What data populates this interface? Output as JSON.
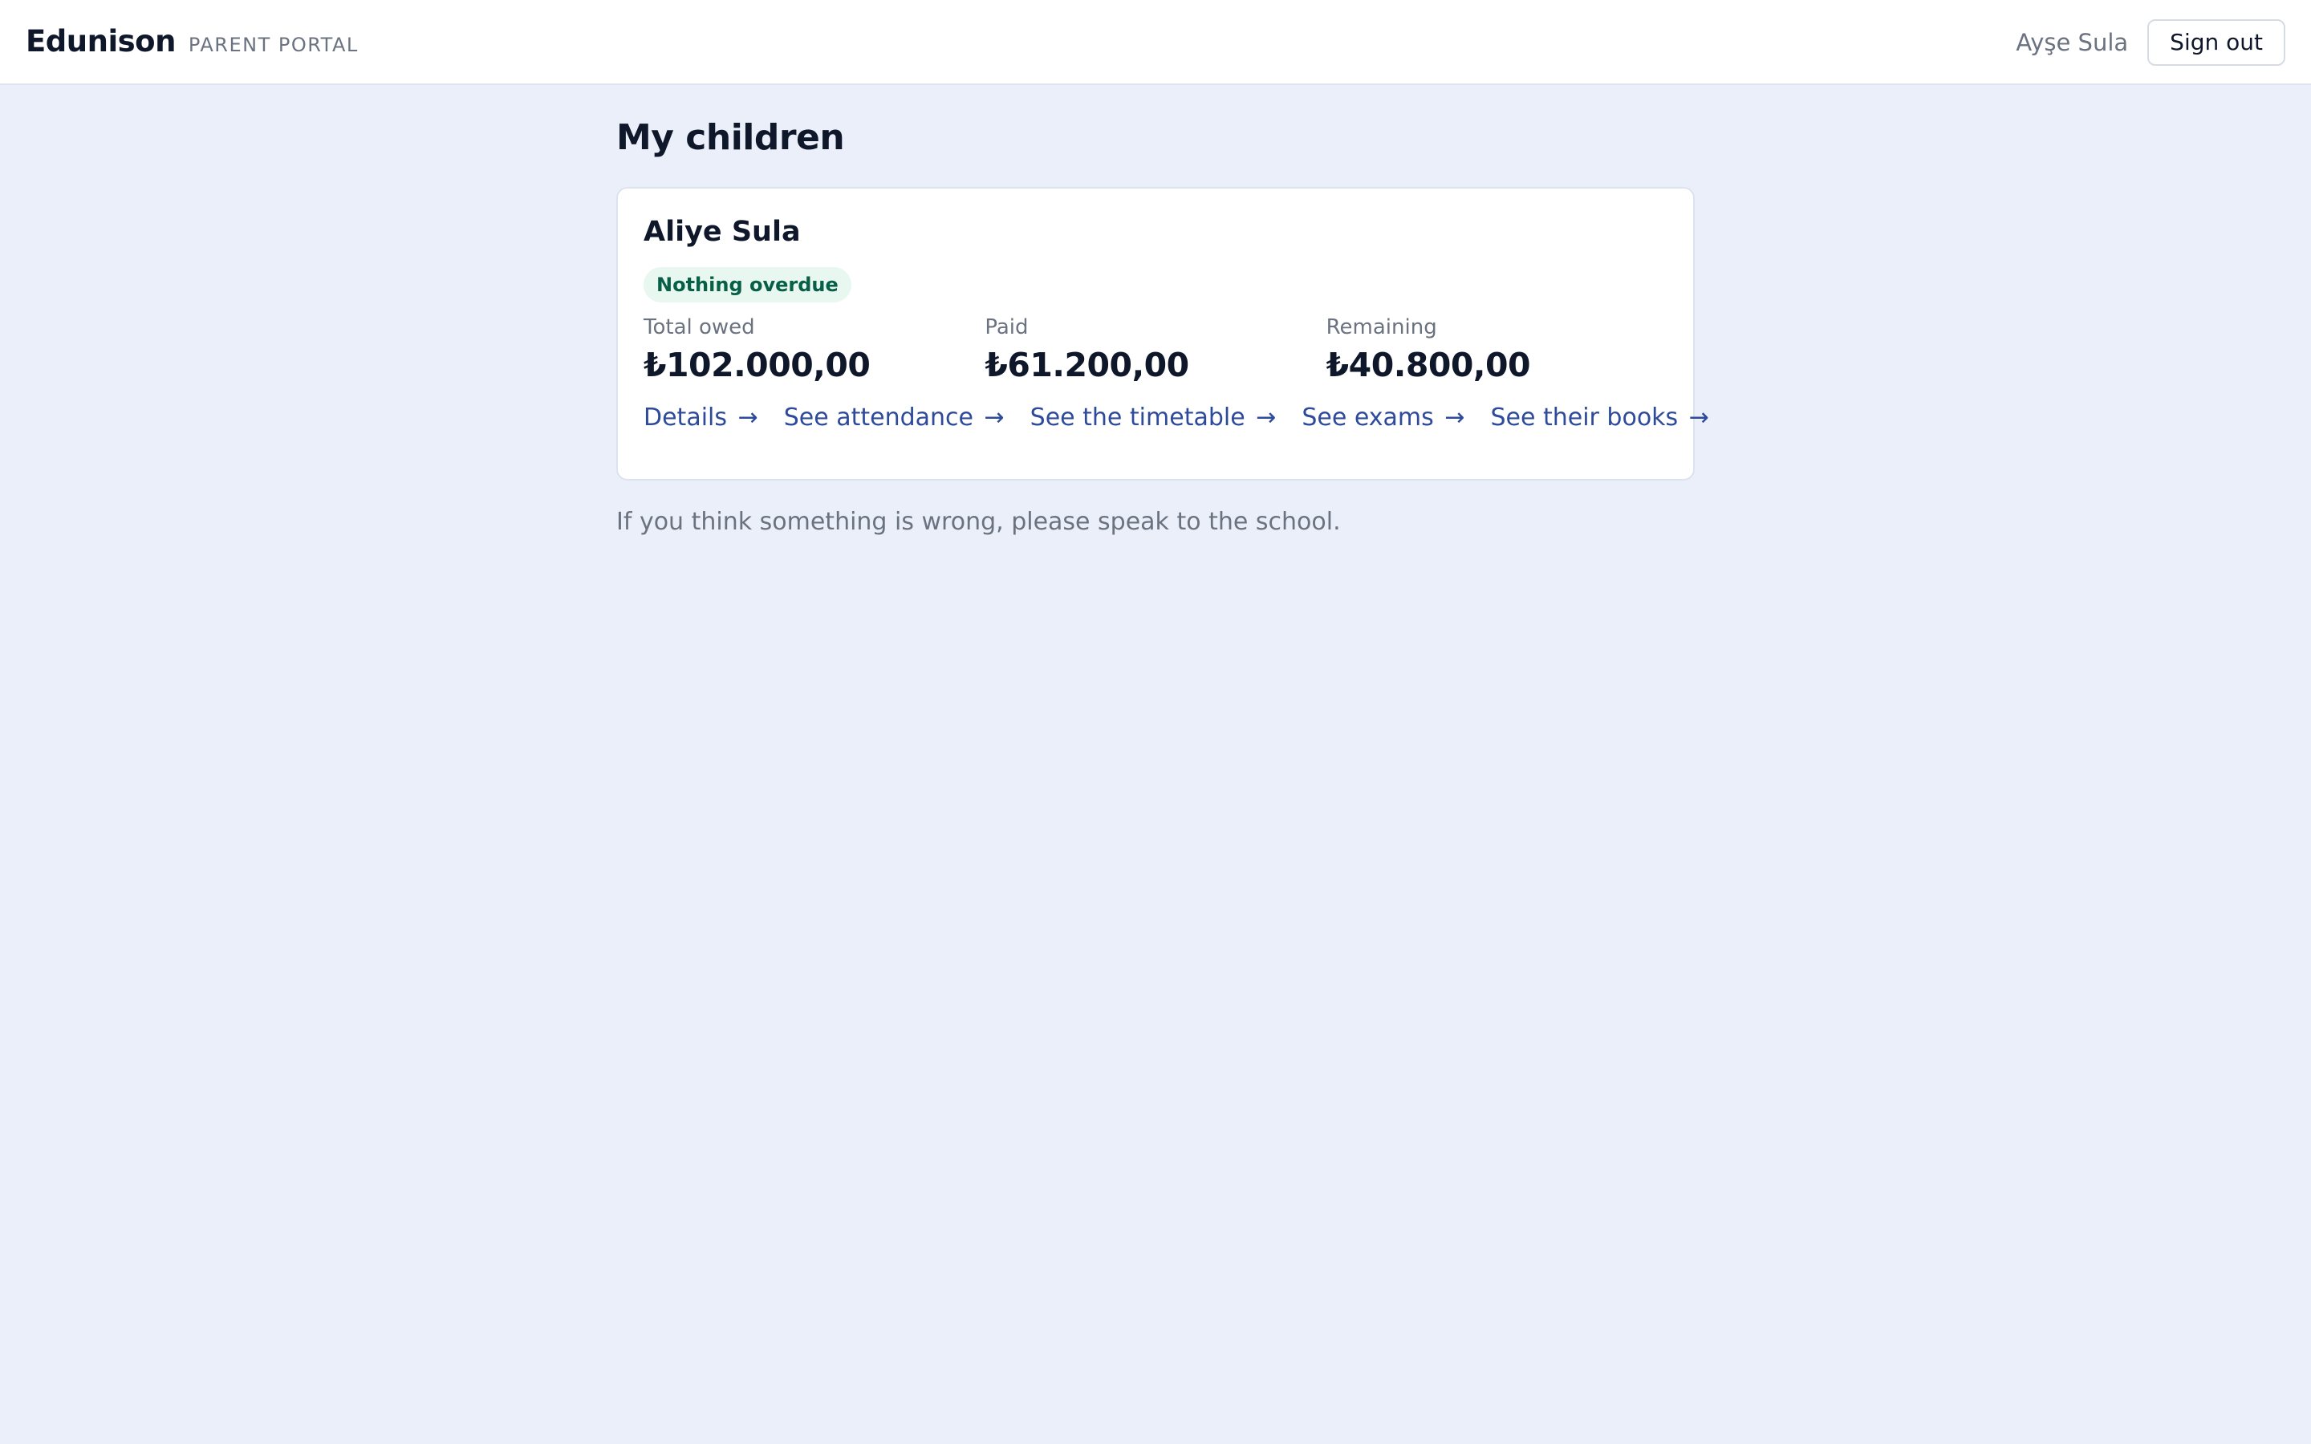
{
  "header": {
    "brand": "Edunison",
    "subtitle": "PARENT PORTAL",
    "user_name": "Ayşe Sula",
    "signout_label": "Sign out"
  },
  "main": {
    "title": "My children",
    "children": [
      {
        "name": "Aliye Sula",
        "status_badge": "Nothing overdue",
        "stats": [
          {
            "label": "Total owed",
            "value": "₺102.000,00"
          },
          {
            "label": "Paid",
            "value": "₺61.200,00"
          },
          {
            "label": "Remaining",
            "value": "₺40.800,00"
          }
        ],
        "links": [
          {
            "label": "Details",
            "arrow": "→"
          },
          {
            "label": "See attendance",
            "arrow": "→"
          },
          {
            "label": "See the timetable",
            "arrow": "→"
          },
          {
            "label": "See exams",
            "arrow": "→"
          },
          {
            "label": "See their books",
            "arrow": "→"
          }
        ]
      }
    ],
    "note": "If you think something is wrong, please speak to the school."
  },
  "colors": {
    "background": "#eaeff9",
    "link": "#2e4a9a",
    "badge_bg": "#e8f7ef",
    "badge_text": "#065f46"
  }
}
